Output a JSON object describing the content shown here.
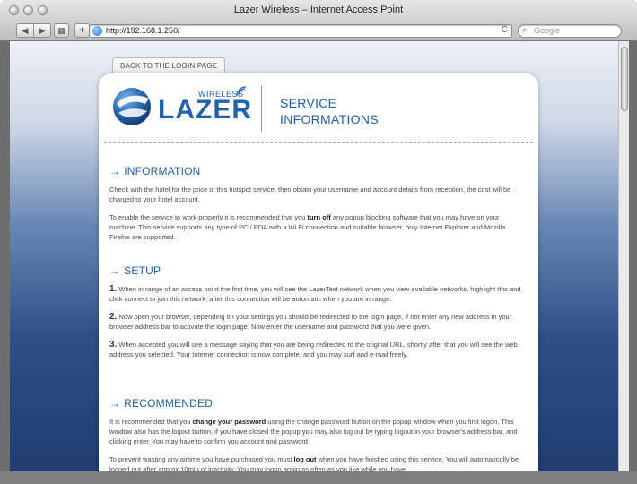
{
  "window": {
    "title": "Lazer Wireless – Internet Access Point"
  },
  "toolbar": {
    "back_label": "◀",
    "forward_label": "▶",
    "grid_label": "▦",
    "add_label": "+",
    "url": "http://192.168.1.250/",
    "reload_label": "C",
    "search_placeholder": "Google"
  },
  "page": {
    "back_tab": "BACK TO THE LOGIN PAGE",
    "logo": {
      "wireless": "WIRELESS",
      "lazer": "LAZER"
    },
    "service_title_line1": "SERVICE",
    "service_title_line2": "INFORMATIONS",
    "sections": {
      "information": {
        "heading": "INFORMATION",
        "p1": "Check with the hotel for the price of this hotspot service, then obtain your username and account details from reception, the cost will be charged to your hotel account.",
        "p2_a": "To enable the service to work properly it is recommended that you ",
        "p2_bold": "turn off",
        "p2_b": " any popup blocking software that you may have on your machine.  This service supports any type of PC / PDA with a Wi Fi connection and suitable browser, only Internet Explorer and Mozilla Firefox are supported."
      },
      "setup": {
        "heading": "SETUP",
        "step1_num": "1.",
        "step1": " When in range of an access point the first time, you will see the LazerTest network when you view available networks, highlight this and click connect to join this network, after this connection will be automatic when you are in range.",
        "step2_num": "2.",
        "step2": " Now open your browser, depending on your settings you should be redirected to the login page, if not enter any new address in your browser address bar to activate the login page.  Now enter the username and password that you were given.",
        "step3_num": "3.",
        "step3": " When accepted you will see a message saying that you are being redirected to the original URL, shortly after that you will see the web address you selected.  Your Internet connection is now complete, and you may surf and e-mail freely."
      },
      "recommended": {
        "heading": "RECOMMENDED",
        "p1_a": "It is recommended that you ",
        "p1_bold": "change your password",
        "p1_b": " using the change password button on the popup window when you first logon.  This window also has the logout button, if you have closed the popup you may also log out by typing logout in your browser's address bar, and clicking enter. You may have to confirm you account and password.",
        "p2_a": "To prevent wasting any airtime you have purchased you must ",
        "p2_bold": "log out",
        "p2_b": " when you have finished using this service.  You will automatically be logged out after approx 10min of inactivity.  You may logon again as often as you like while you have"
      }
    }
  },
  "colors": {
    "accent": "#1f5ea8",
    "text": "#4a4a4a"
  },
  "icons": {
    "arrow": "→"
  }
}
